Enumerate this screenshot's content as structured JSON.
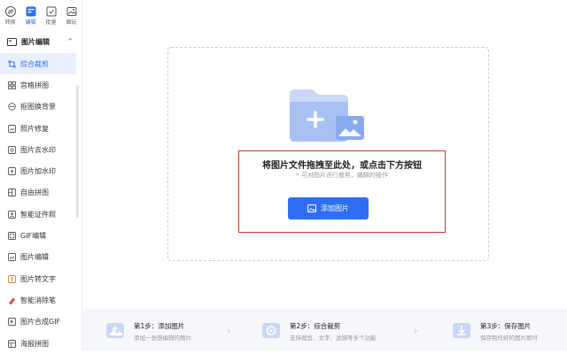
{
  "topnav": [
    {
      "label": "转换",
      "icon": "convert-icon"
    },
    {
      "label": "编辑",
      "icon": "edit-icon"
    },
    {
      "label": "批量",
      "icon": "batch-icon"
    },
    {
      "label": "图玩",
      "icon": "image-play-icon"
    }
  ],
  "section": {
    "title": "图片编辑",
    "chevron": "^"
  },
  "menu": [
    {
      "label": "综合裁剪"
    },
    {
      "label": "宫格拼图"
    },
    {
      "label": "抠图换背景"
    },
    {
      "label": "照片修复"
    },
    {
      "label": "图片去水印"
    },
    {
      "label": "图片加水印"
    },
    {
      "label": "自由拼图"
    },
    {
      "label": "智能证件照"
    },
    {
      "label": "GIF编辑"
    },
    {
      "label": "图片编辑"
    },
    {
      "label": "图片转文字"
    },
    {
      "label": "智能消除笔"
    },
    {
      "label": "图片合成GIF"
    },
    {
      "label": "海报拼图"
    }
  ],
  "upload": {
    "title": "将图片文件拖拽至此处，或点击下方按钮",
    "subtitle": "* 可对图片进行裁剪，编辑的操作",
    "button_label": "添加图片"
  },
  "steps": [
    {
      "title": "第1步：添加图片",
      "desc": "添加一张想编辑的图片"
    },
    {
      "title": "第2步：综合裁剪",
      "desc": "支持裁剪、文字、滤镜等多个功能"
    },
    {
      "title": "第3步：保存图片",
      "desc": "保存制作好的图片即可"
    }
  ],
  "colors": {
    "accent": "#2f6df6",
    "highlight_border": "#c0392b"
  }
}
